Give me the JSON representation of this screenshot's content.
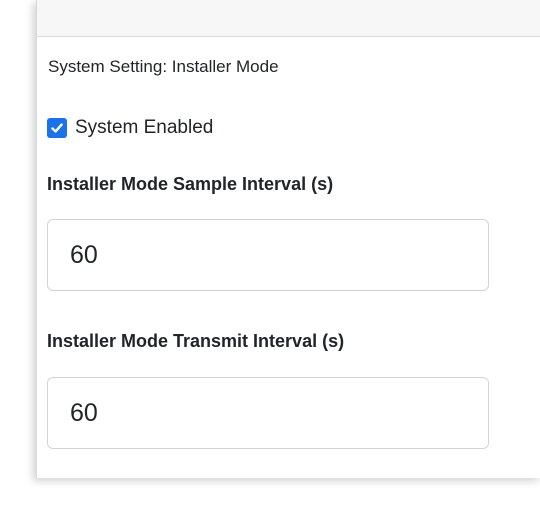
{
  "settings": {
    "section_title": "System Setting: Installer Mode",
    "system_enabled": {
      "label": "System Enabled",
      "checked": true
    },
    "sample_interval": {
      "label": "Installer Mode Sample Interval (s)",
      "value": "60"
    },
    "transmit_interval": {
      "label": "Installer Mode Transmit Interval (s)",
      "value": "60"
    }
  },
  "colors": {
    "checkbox_accent": "#1a73e8",
    "text": "#212529",
    "input_border": "#ced4da",
    "header_bg": "#f7f7f7"
  },
  "icons": {
    "checkbox": "checkmark-icon"
  }
}
